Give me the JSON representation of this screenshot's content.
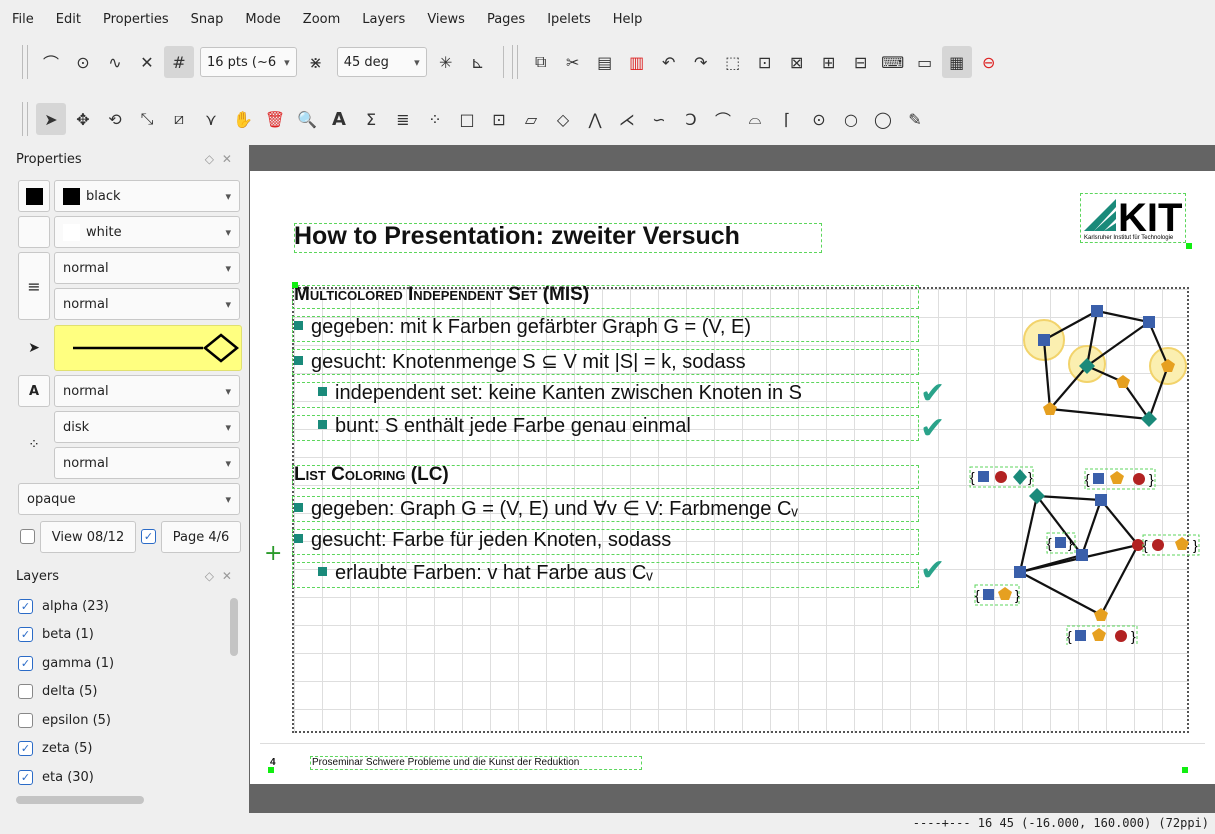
{
  "menu": [
    "File",
    "Edit",
    "Properties",
    "Snap",
    "Mode",
    "Zoom",
    "Layers",
    "Views",
    "Pages",
    "Ipelets",
    "Help"
  ],
  "toolbar1": {
    "grid_size": "16 pts (~6",
    "angle": "45 deg"
  },
  "properties": {
    "title": "Properties",
    "stroke_color": "black",
    "fill_color": "white",
    "pen_width": "normal",
    "dash_style": "normal",
    "text_size": "normal",
    "mark_shape": "disk",
    "mark_size": "normal",
    "opacity": "opaque",
    "view_label": "View 08/12",
    "page_label": "Page 4/6",
    "colors": {
      "stroke": "#000000",
      "fill": "#ffffff",
      "arrow_bg": "#ffff80"
    }
  },
  "layers": {
    "title": "Layers",
    "items": [
      {
        "label": "alpha (23)",
        "checked": true
      },
      {
        "label": "beta (1)",
        "checked": true
      },
      {
        "label": "gamma (1)",
        "checked": true
      },
      {
        "label": "delta (5)",
        "checked": false
      },
      {
        "label": "epsilon (5)",
        "checked": false
      },
      {
        "label": "zeta (5)",
        "checked": true
      },
      {
        "label": "eta (30)",
        "checked": true
      }
    ]
  },
  "slide": {
    "title": "How to Presentation: zweiter Versuch",
    "logo_text": "KIT",
    "logo_sub": "Karlsruher Institut für Technologie",
    "mis_heading": "Multicolored Independent Set (MIS)",
    "mis_items": [
      "gegeben: mit k Farben gefärbter Graph G = (V, E)",
      "gesucht: Knotenmenge S ⊆ V mit |S| = k, sodass",
      "independent set: keine Kanten zwischen Knoten in S",
      "bunt: S enthält jede Farbe genau einmal"
    ],
    "lc_heading": "List Coloring (LC)",
    "lc_items": [
      "gegeben: Graph G = (V, E) und ∀v ∈ V: Farbmenge Cᵥ",
      "gesucht: Farbe für jeden Knoten, sodass",
      "erlaubte Farben: v hat Farbe aus Cᵥ"
    ],
    "footer_page": "4",
    "footer_text": "Proseminar Schwere Probleme und die Kunst der Reduktion",
    "colors": {
      "teal": "#1a8a7a",
      "blue": "#3a5faa",
      "red": "#b22222",
      "orange": "#e6a020",
      "check": "#2aa38a",
      "selection": "#5cd65c"
    }
  },
  "status": "----+--- 16 45 (-16.000, 160.000) (72ppi)"
}
